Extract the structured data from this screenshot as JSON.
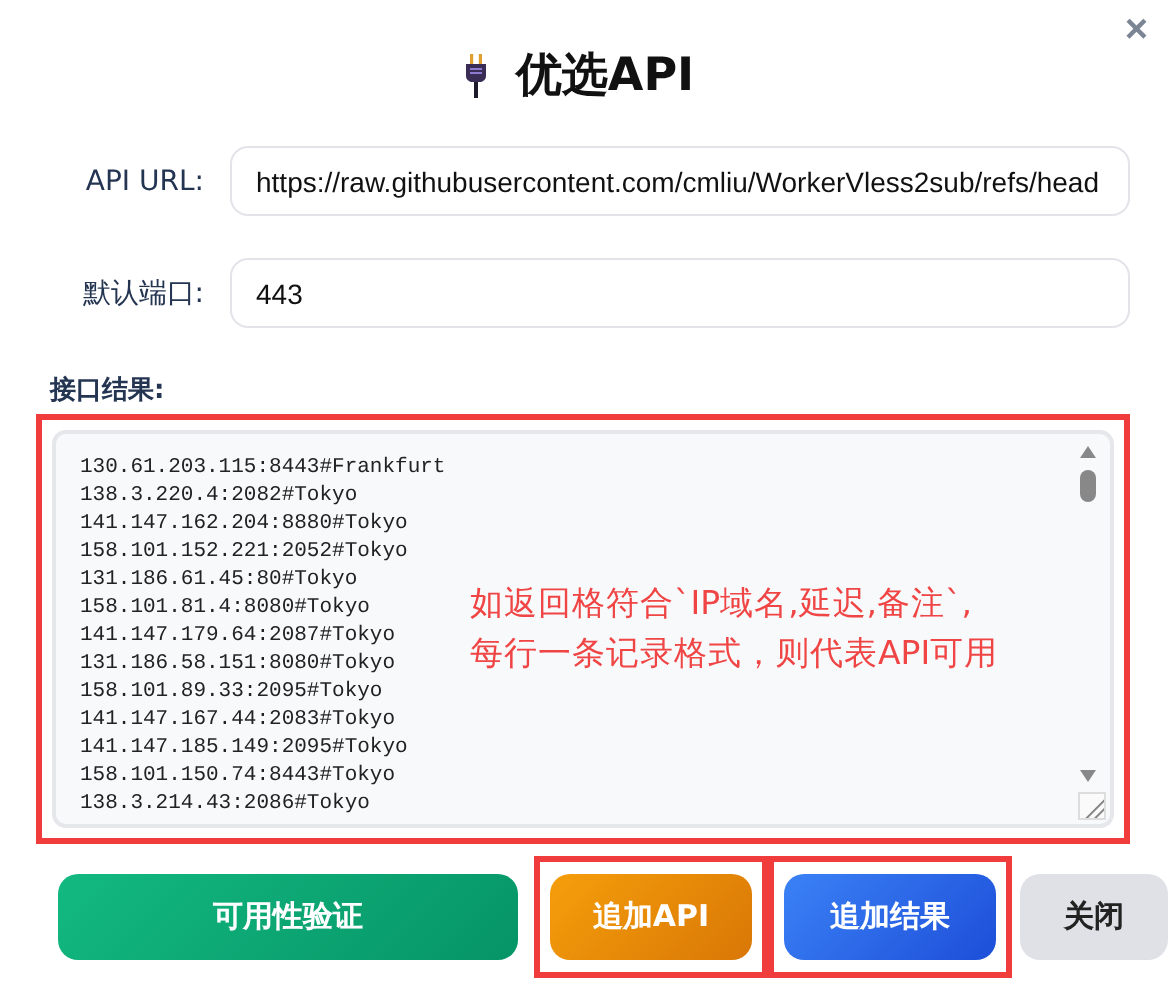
{
  "dialog": {
    "title": "优选API",
    "close": "×"
  },
  "fields": [
    {
      "label": "API URL:",
      "value": "https://raw.githubusercontent.com/cmliu/WorkerVless2sub/refs/head"
    },
    {
      "label": "默认端口:",
      "value": "443"
    }
  ],
  "results": {
    "label": "接口结果:",
    "highlighted": true,
    "lines": [
      "130.61.203.115:8443#Frankfurt",
      "138.3.220.4:2082#Tokyo",
      "141.147.162.204:8880#Tokyo",
      "158.101.152.221:2052#Tokyo",
      "131.186.61.45:80#Tokyo",
      "158.101.81.4:8080#Tokyo",
      "141.147.179.64:2087#Tokyo",
      "131.186.58.151:8080#Tokyo",
      "158.101.89.33:2095#Tokyo",
      "141.147.167.44:2083#Tokyo",
      "141.147.185.149:2095#Tokyo",
      "158.101.150.74:8443#Tokyo",
      "138.3.214.43:2086#Tokyo"
    ],
    "annotation": [
      "如返回格符合`IP域名,延迟,备注`,",
      "每行一条记录格式，则代表API可用"
    ]
  },
  "buttons": [
    {
      "label": "可用性验证",
      "kind": "green",
      "highlighted": false
    },
    {
      "label": "追加API",
      "kind": "orange",
      "highlighted": true
    },
    {
      "label": "追加结果",
      "kind": "blue",
      "highlighted": true
    },
    {
      "label": "关闭",
      "kind": "grey",
      "highlighted": false
    }
  ]
}
